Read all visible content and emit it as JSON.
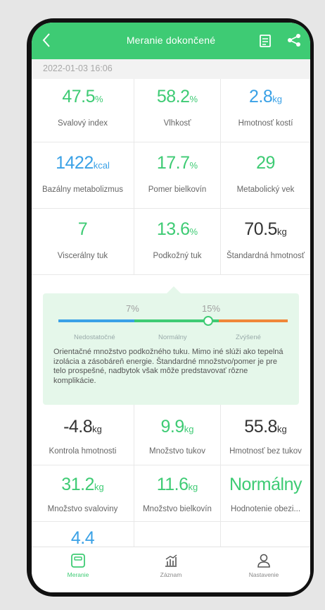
{
  "header": {
    "title": "Meranie dokončené"
  },
  "date": "2022-01-03 16:06",
  "metrics_top": [
    {
      "value": "47.5",
      "unit": "%",
      "label": "Svalový index",
      "color": "green"
    },
    {
      "value": "58.2",
      "unit": "%",
      "label": "Vlhkosť",
      "color": "green"
    },
    {
      "value": "2.8",
      "unit": "kg",
      "label": "Hmotnosť kostí",
      "color": "blue"
    },
    {
      "value": "1422",
      "unit": "kcal",
      "label": "Bazálny metabolizmus",
      "color": "blue"
    },
    {
      "value": "17.7",
      "unit": "%",
      "label": "Pomer bielkovín",
      "color": "green"
    },
    {
      "value": "29",
      "unit": "",
      "label": "Metabolický vek",
      "color": "green"
    },
    {
      "value": "7",
      "unit": "",
      "label": "Viscerálny tuk",
      "color": "green"
    },
    {
      "value": "13.6",
      "unit": "%",
      "label": "Podkožný tuk",
      "color": "green"
    },
    {
      "value": "70.5",
      "unit": "kg",
      "label": "Štandardná hmotnosť",
      "color": "dark"
    }
  ],
  "detail": {
    "low_threshold": "7%",
    "high_threshold": "15%",
    "ranges": [
      "Nedostatočné",
      "Normálny",
      "Zvýšené"
    ],
    "description": "Orientačné množstvo podkožného tuku. Mimo iné slúži ako tepelná izolácia a zásobáreň energie. Štandardné množstvo/pomer je pre telo prospešné, nadbytok však môže predstavovať rôzne komplikácie.",
    "colors": {
      "low": "#3aa1e6",
      "normal": "#3ecb74",
      "high": "#f0873a"
    }
  },
  "metrics_bottom": [
    {
      "value": "-4.8",
      "unit": "kg",
      "label": "Kontrola hmotnosti",
      "color": "dark"
    },
    {
      "value": "9.9",
      "unit": "kg",
      "label": "Množstvo tukov",
      "color": "green"
    },
    {
      "value": "55.8",
      "unit": "kg",
      "label": "Hmotnosť bez tukov",
      "color": "dark"
    },
    {
      "value": "31.2",
      "unit": "kg",
      "label": "Množstvo svaloviny",
      "color": "green"
    },
    {
      "value": "11.6",
      "unit": "kg",
      "label": "Množstvo bielkovín",
      "color": "green"
    },
    {
      "value": "Normálny",
      "unit": "",
      "label": "Hodnotenie obezi...",
      "color": "green"
    }
  ],
  "metrics_partial": [
    {
      "value": "4.4",
      "color": "blue"
    }
  ],
  "tabs": [
    {
      "label": "Meranie",
      "icon": "scale-icon",
      "active": true
    },
    {
      "label": "Záznam",
      "icon": "chart-icon",
      "active": false
    },
    {
      "label": "Nastavenie",
      "icon": "user-icon",
      "active": false
    }
  ],
  "accent": "#3ecb74"
}
